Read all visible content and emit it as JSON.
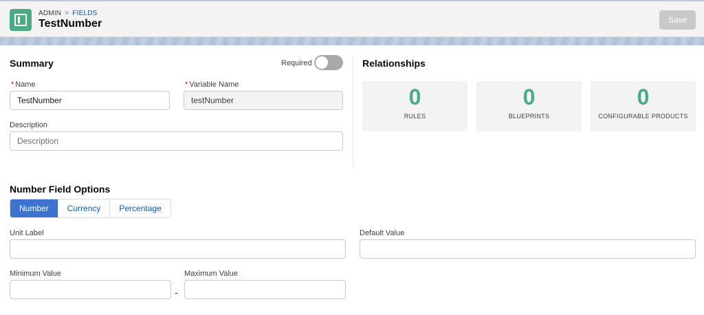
{
  "header": {
    "breadcrumb": [
      "ADMIN",
      ">",
      "FIELDS"
    ],
    "title": "TestNumber",
    "save_label": "Save"
  },
  "summary": {
    "title": "Summary",
    "required_label": "Required",
    "required_on": false,
    "name_label": "Name",
    "name_value": "TestNumber",
    "variable_label": "Variable Name",
    "variable_value": "testNumber",
    "description_label": "Description",
    "description_placeholder": "Description"
  },
  "relationships": {
    "title": "Relationships",
    "stats": [
      {
        "count": "0",
        "caption": "RULES"
      },
      {
        "count": "0",
        "caption": "BLUEPRINTS"
      },
      {
        "count": "0",
        "caption": "CONFIGURABLE PRODUCTS"
      }
    ]
  },
  "number_options": {
    "title": "Number Field Options",
    "tabs": [
      "Number",
      "Currency",
      "Percentage"
    ],
    "active_tab": "Number",
    "unit_label": "Unit Label",
    "default_label": "Default Value",
    "min_label": "Minimum Value",
    "max_label": "Maximum Value",
    "range_separator": "-"
  },
  "colors": {
    "accent": "#3b73cf",
    "stat_number": "#4bab84",
    "app_icon": "#4bab84"
  },
  "icons": {
    "app": "field-app-icon"
  }
}
